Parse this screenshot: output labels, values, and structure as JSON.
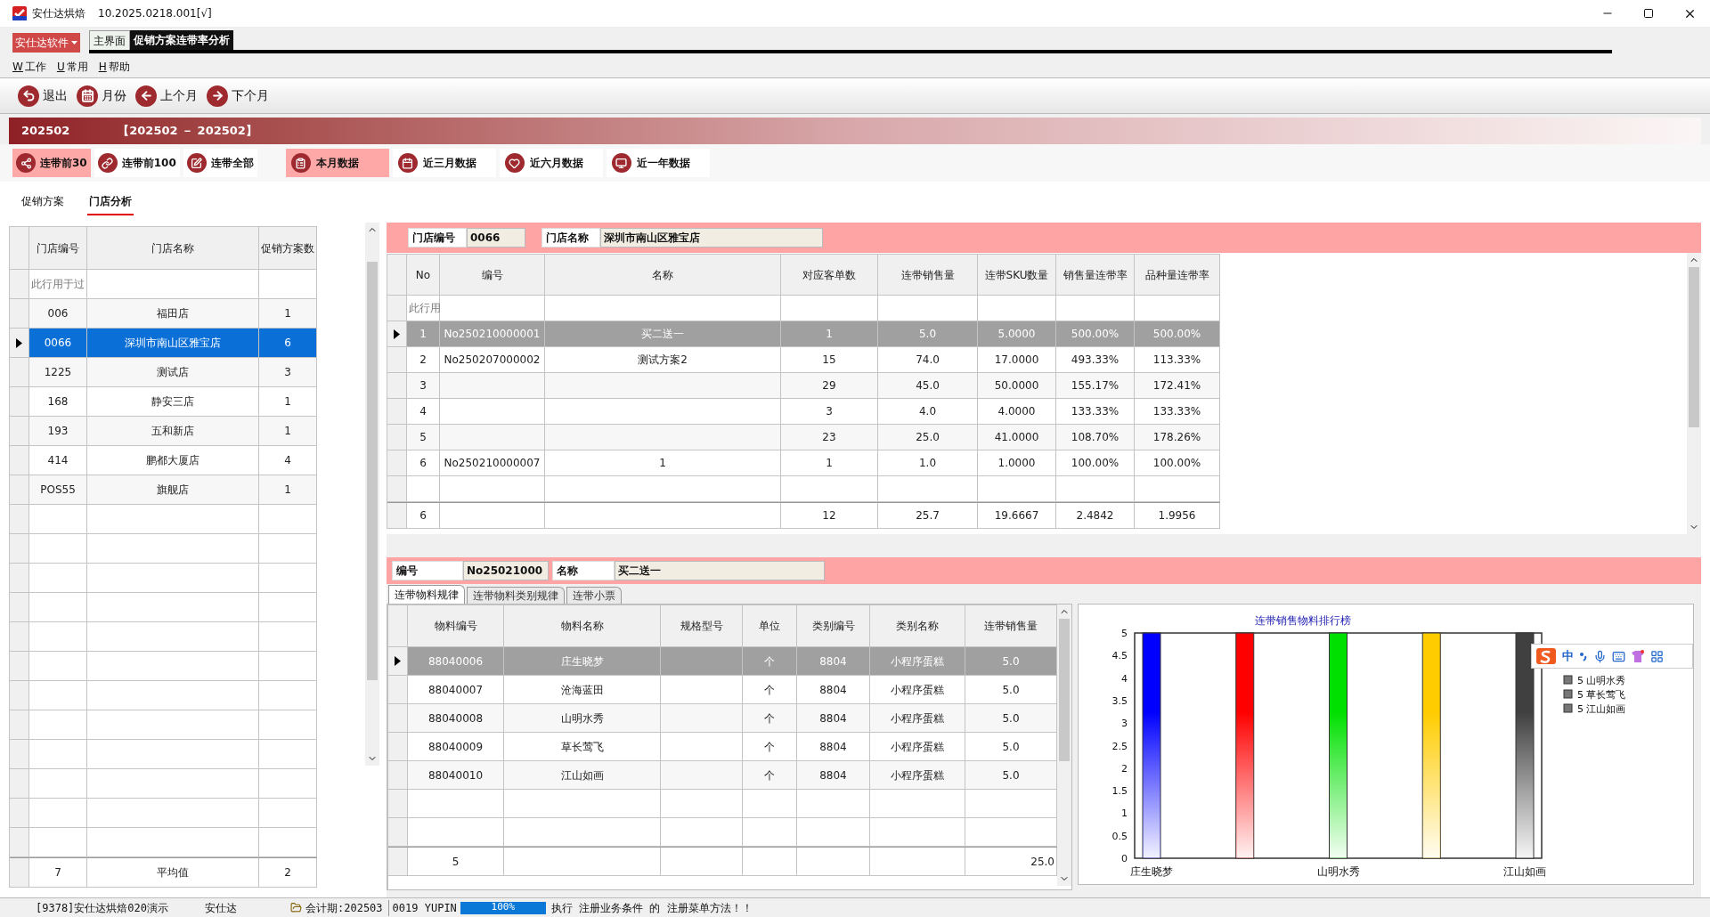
{
  "window": {
    "title": "安仕达烘焙",
    "version": "10.2025.0218.001[√]"
  },
  "app_menu": "安仕达软件",
  "doc_tabs": [
    {
      "label": "主界面",
      "selected": false
    },
    {
      "label": "促销方案连带率分析",
      "selected": true
    }
  ],
  "menu": [
    {
      "key": "W",
      "label": "工作"
    },
    {
      "key": "U",
      "label": "常用"
    },
    {
      "key": "H",
      "label": "帮助"
    }
  ],
  "toolbar": [
    "退出",
    "月份",
    "上个月",
    "下个月"
  ],
  "banner": {
    "period": "202502",
    "range": "【202502 － 202502】"
  },
  "filters": [
    {
      "label": "连带前30",
      "selected": true
    },
    {
      "label": "连带前100",
      "selected": false
    },
    {
      "label": "连带全部",
      "selected": false
    }
  ],
  "ranges": [
    {
      "label": "本月数据",
      "selected": true
    },
    {
      "label": "近三月数据",
      "selected": false
    },
    {
      "label": "近六月数据",
      "selected": false
    },
    {
      "label": "近一年数据",
      "selected": false
    }
  ],
  "view_tabs": [
    {
      "label": "促销方案",
      "selected": false
    },
    {
      "label": "门店分析",
      "selected": true
    }
  ],
  "stores": {
    "columns": [
      "门店编号",
      "门店名称",
      "促销方案数"
    ],
    "filter_hint": "此行用于过",
    "rows": [
      {
        "code": "006",
        "name": "福田店",
        "count": "1",
        "selected": false
      },
      {
        "code": "0066",
        "name": "深圳市南山区雅宝店",
        "count": "6",
        "selected": true
      },
      {
        "code": "1225",
        "name": "测试店",
        "count": "3",
        "selected": false
      },
      {
        "code": "168",
        "name": "静安三店",
        "count": "1",
        "selected": false
      },
      {
        "code": "193",
        "name": "五和新店",
        "count": "1",
        "selected": false
      },
      {
        "code": "414",
        "name": "鹏都大厦店",
        "count": "4",
        "selected": false
      },
      {
        "code": "POS55",
        "name": "旗舰店",
        "count": "1",
        "selected": false
      }
    ],
    "footer": {
      "code": "7",
      "name": "平均值",
      "count": "2"
    }
  },
  "store_info": {
    "code_label": "门店编号",
    "code": "0066",
    "name_label": "门店名称",
    "name": "深圳市南山区雅宝店"
  },
  "plans": {
    "columns": [
      "No",
      "编号",
      "名称",
      "对应客单数",
      "连带销售量",
      "连带SKU数量",
      "销售量连带率",
      "品种量连带率"
    ],
    "filter_hint": "此行用",
    "rows": [
      {
        "no": "1",
        "code": "No250210000001",
        "name": "买二送一",
        "orders": "1",
        "sales": "5.0",
        "sku": "5.0000",
        "sales_rate": "500.00%",
        "variety_rate": "500.00%",
        "selected": true
      },
      {
        "no": "2",
        "code": "No250207000002",
        "name": "测试方案2",
        "orders": "15",
        "sales": "74.0",
        "sku": "17.0000",
        "sales_rate": "493.33%",
        "variety_rate": "113.33%",
        "selected": false
      },
      {
        "no": "3",
        "orders": "29",
        "sales": "45.0",
        "sku": "50.0000",
        "sales_rate": "155.17%",
        "variety_rate": "172.41%",
        "selected": false
      },
      {
        "no": "4",
        "orders": "3",
        "sales": "4.0",
        "sku": "4.0000",
        "sales_rate": "133.33%",
        "variety_rate": "133.33%",
        "selected": false
      },
      {
        "no": "5",
        "orders": "23",
        "sales": "25.0",
        "sku": "41.0000",
        "sales_rate": "108.70%",
        "variety_rate": "178.26%",
        "selected": false
      },
      {
        "no": "6",
        "code": "No250210000007",
        "name": "1",
        "orders": "1",
        "sales": "1.0",
        "sku": "1.0000",
        "sales_rate": "100.00%",
        "variety_rate": "100.00%",
        "selected": false
      }
    ],
    "footer": {
      "no": "6",
      "orders": "12",
      "sales": "25.7",
      "sku": "19.6667",
      "sales_rate": "2.4842",
      "variety_rate": "1.9956"
    }
  },
  "plan_info": {
    "code_label": "编号",
    "code": "No25021000",
    "name_label": "名称",
    "name": "买二送一"
  },
  "detail_tabs": [
    {
      "label": "连带物料规律",
      "selected": true
    },
    {
      "label": "连带物料类别规律",
      "selected": false
    },
    {
      "label": "连带小票",
      "selected": false
    }
  ],
  "items": {
    "columns": [
      "物料编号",
      "物料名称",
      "规格型号",
      "单位",
      "类别编号",
      "类别名称",
      "连带销售量"
    ],
    "rows": [
      {
        "code": "88040006",
        "name": "庄生晓梦",
        "unit": "个",
        "cat_code": "8804",
        "cat_name": "小程序蛋糕",
        "qty": "5.0",
        "selected": true
      },
      {
        "code": "88040007",
        "name": "沧海蓝田",
        "unit": "个",
        "cat_code": "8804",
        "cat_name": "小程序蛋糕",
        "qty": "5.0",
        "selected": false
      },
      {
        "code": "88040008",
        "name": "山明水秀",
        "unit": "个",
        "cat_code": "8804",
        "cat_name": "小程序蛋糕",
        "qty": "5.0",
        "selected": false
      },
      {
        "code": "88040009",
        "name": "草长莺飞",
        "unit": "个",
        "cat_code": "8804",
        "cat_name": "小程序蛋糕",
        "qty": "5.0",
        "selected": false
      },
      {
        "code": "88040010",
        "name": "江山如画",
        "unit": "个",
        "cat_code": "8804",
        "cat_name": "小程序蛋糕",
        "qty": "5.0",
        "selected": false
      }
    ],
    "footer": {
      "code": "5",
      "qty": "25.0"
    }
  },
  "chart": {
    "chart_data": {
      "type": "bar",
      "title": "连带销售物料排行榜",
      "categories": [
        "庄生晓梦",
        null,
        "山明水秀",
        null,
        "江山如画"
      ],
      "series": [
        {
          "values": [
            5,
            5,
            5,
            5,
            5
          ]
        }
      ],
      "ylim": [
        0,
        5
      ],
      "yticks": [
        0,
        0.5,
        1,
        1.5,
        2,
        2.5,
        3,
        3.5,
        4,
        4.5,
        5
      ]
    },
    "legend": [
      "5 山明水秀",
      "5 草长莺飞",
      "5 江山如画"
    ]
  },
  "ime": {
    "label": "中"
  },
  "status": {
    "company": "[9378]安仕达烘焙020演示",
    "user": "安仕达",
    "period": "会计期:202503",
    "code": "0019 YUPIN",
    "progress": {
      "level": 1,
      "reading": "100%"
    },
    "message": "执行 注册业务条件 的 注册菜单方法！！"
  }
}
